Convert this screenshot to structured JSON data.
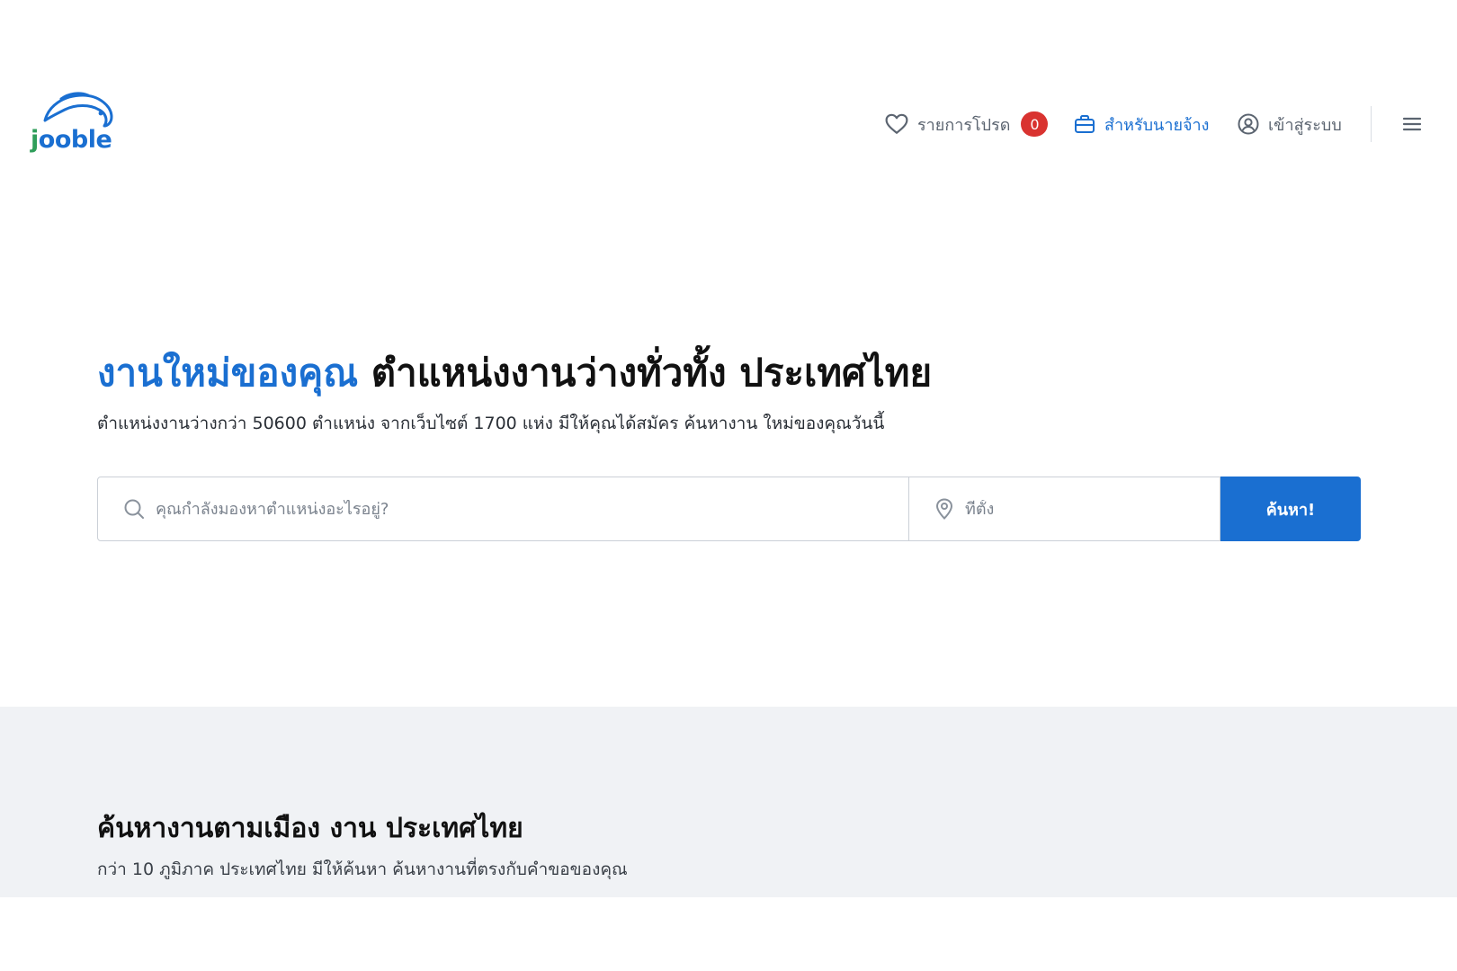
{
  "brand": {
    "logo_j": "j",
    "logo_rest": "ooble",
    "accent_color": "#1a6fd1",
    "green_color": "#2f9e5a"
  },
  "header": {
    "favorites_label": "รายการโปรด",
    "favorites_count": "0",
    "employer_label": "สำหรับนายจ้าง",
    "login_label": "เข้าสู่ระบบ",
    "icons": [
      "heart-icon",
      "briefcase-icon",
      "user-circle-icon",
      "hamburger-menu-icon"
    ]
  },
  "hero": {
    "title_accent": "งานใหม่ของคุณ",
    "title_rest": " ตำแหน่งงานว่างทั่วทั้ง ประเทศไทย",
    "subtitle": "ตำแหน่งงานว่างกว่า 50600 ตำแหน่ง จากเว็บไซต์ 1700 แห่ง มีให้คุณได้สมัคร ค้นหางาน ใหม่ของคุณวันนี้"
  },
  "search": {
    "keyword_placeholder": "คุณกำลังมองหาตำแหน่งอะไรอยู่?",
    "location_placeholder": "ที่ตั้ง",
    "button_label": "ค้นหา!"
  },
  "cities": {
    "title": "ค้นหางานตามเมือง งาน ประเทศไทย",
    "subtitle": "กว่า 10 ภูมิภาค ประเทศไทย มีให้ค้นหา ค้นหางานที่ตรงกับคำขอของคุณ"
  }
}
